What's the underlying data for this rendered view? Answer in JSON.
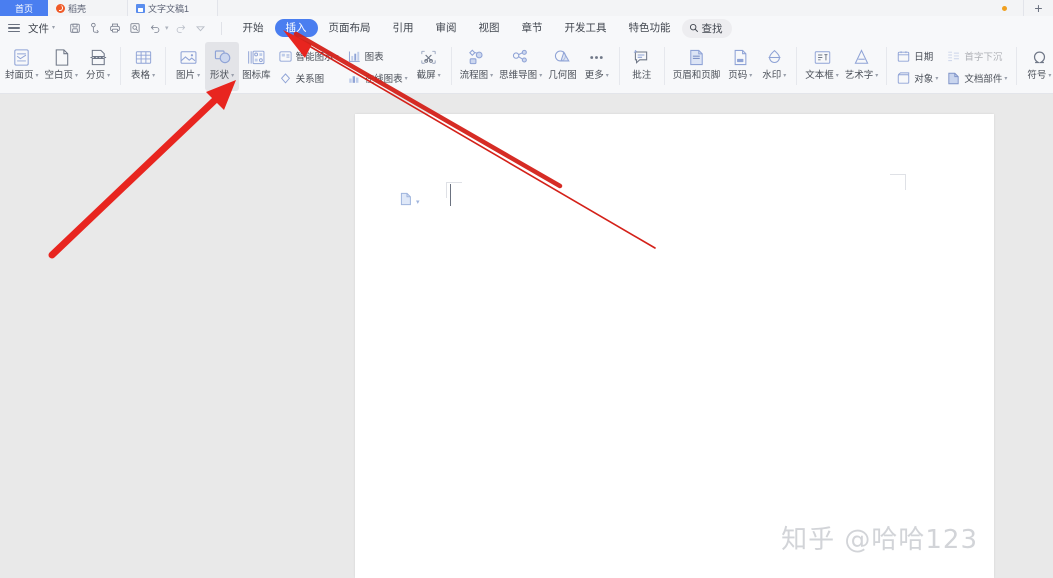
{
  "window": {
    "tabs": [
      {
        "label": "首页",
        "icon": "home-tab",
        "active": true
      },
      {
        "label": "稻壳",
        "icon": "docer-icon",
        "active": false
      },
      {
        "label": "文字文稿1",
        "icon": "document-icon",
        "active": false
      }
    ],
    "new_tab_label": "+",
    "modified_dot": true
  },
  "menubar": {
    "file_label": "文件",
    "quick_access": [
      "save-icon",
      "share-icon",
      "print-icon",
      "print-preview-icon",
      "undo-icon",
      "redo-icon",
      "customize-qat-icon"
    ],
    "ribbon_tabs": [
      {
        "label": "开始",
        "active": false
      },
      {
        "label": "插入",
        "active": true
      },
      {
        "label": "页面布局",
        "active": false
      },
      {
        "label": "引用",
        "active": false
      },
      {
        "label": "审阅",
        "active": false
      },
      {
        "label": "视图",
        "active": false
      },
      {
        "label": "章节",
        "active": false
      },
      {
        "label": "开发工具",
        "active": false
      },
      {
        "label": "特色功能",
        "active": false
      }
    ],
    "find_label": "查找"
  },
  "ribbon": {
    "groups": [
      {
        "items": [
          {
            "label": "封面页",
            "icon": "cover-page-icon",
            "caret": true,
            "selected": false,
            "dim": false
          },
          {
            "label": "空白页",
            "icon": "blank-page-icon",
            "caret": true,
            "selected": false,
            "dim": false
          },
          {
            "label": "分页",
            "icon": "page-break-icon",
            "caret": true,
            "selected": false,
            "dim": false
          }
        ]
      },
      {
        "items": [
          {
            "label": "表格",
            "icon": "table-icon",
            "caret": true,
            "selected": false,
            "dim": false
          }
        ]
      },
      {
        "items": [
          {
            "label": "图片",
            "icon": "picture-icon",
            "caret": true,
            "selected": false,
            "dim": false
          },
          {
            "label": "形状",
            "icon": "shapes-icon",
            "caret": true,
            "selected": true,
            "dim": false
          },
          {
            "label": "图标库",
            "icon": "icon-library-icon",
            "caret": false,
            "selected": false,
            "dim": false
          }
        ]
      },
      {
        "stacked": [
          {
            "label": "智能图示",
            "icon": "smartart-icon",
            "caret": true
          },
          {
            "label": "关系图",
            "icon": "relation-chart-icon",
            "caret": false
          }
        ]
      },
      {
        "stacked": [
          {
            "label": "图表",
            "icon": "chart-icon",
            "caret": false
          },
          {
            "label": "在线图表",
            "icon": "online-chart-icon",
            "caret": true
          }
        ]
      },
      {
        "items": [
          {
            "label": "截屏",
            "icon": "screenshot-icon",
            "caret": true,
            "selected": false,
            "dim": false
          }
        ]
      },
      {
        "items": [
          {
            "label": "流程图",
            "icon": "flowchart-icon",
            "caret": true,
            "selected": false,
            "dim": false
          },
          {
            "label": "思维导图",
            "icon": "mindmap-icon",
            "caret": true,
            "selected": false,
            "dim": false
          },
          {
            "label": "几何图",
            "icon": "geometry-icon",
            "caret": false,
            "selected": false,
            "dim": false
          },
          {
            "label": "更多",
            "icon": "more-icon",
            "caret": true,
            "selected": false,
            "dim": false
          }
        ]
      },
      {
        "items": [
          {
            "label": "批注",
            "icon": "comment-icon",
            "caret": false,
            "selected": false,
            "dim": false
          }
        ]
      },
      {
        "items": [
          {
            "label": "页眉和页脚",
            "icon": "header-footer-icon",
            "caret": false,
            "selected": false,
            "dim": false
          },
          {
            "label": "页码",
            "icon": "page-number-icon",
            "caret": true,
            "selected": false,
            "dim": false
          },
          {
            "label": "水印",
            "icon": "watermark-icon",
            "caret": true,
            "selected": false,
            "dim": false
          }
        ]
      },
      {
        "items": [
          {
            "label": "文本框",
            "icon": "textbox-icon",
            "caret": true,
            "selected": false,
            "dim": false
          },
          {
            "label": "艺术字",
            "icon": "wordart-icon",
            "caret": true,
            "selected": false,
            "dim": false
          }
        ]
      },
      {
        "stacked": [
          {
            "label": "日期",
            "icon": "date-icon",
            "caret": false
          },
          {
            "label": "对象",
            "icon": "object-icon",
            "caret": true
          }
        ]
      },
      {
        "stacked": [
          {
            "label": "首字下沉",
            "icon": "drop-cap-icon",
            "caret": false,
            "dim": true
          },
          {
            "label": "文档部件",
            "icon": "doc-parts-icon",
            "caret": true,
            "dim": false
          }
        ]
      },
      {
        "items": [
          {
            "label": "符号",
            "icon": "symbol-icon",
            "caret": true,
            "selected": false,
            "dim": false
          }
        ]
      }
    ]
  },
  "document": {
    "paste_options_icon": "paste-options-icon",
    "cursor": "text-caret",
    "margin_marks": 2
  },
  "watermark": {
    "text": "知乎 @哈哈123"
  },
  "annotations": {
    "arrow_thick": {
      "points_to": "形状",
      "color": "#e8251f"
    },
    "arrow_thin": {
      "points_to": "插入",
      "color": "#d42119"
    }
  },
  "colors": {
    "accent_blue": "#4a7ef0",
    "icon_blue": "#8fa3d6",
    "workspace_gray": "#e9e9e9",
    "ribbon_bg": "#f7f8fa",
    "annotation_red": "#e8251f"
  }
}
